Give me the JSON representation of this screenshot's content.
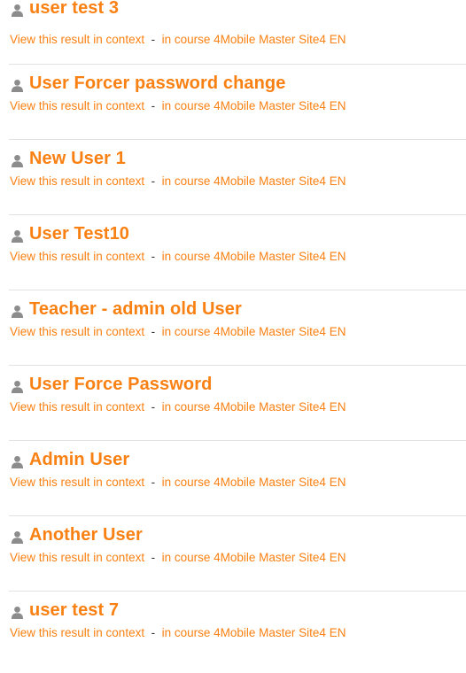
{
  "colors": {
    "accent": "#f98012",
    "divider": "#e2e2e2",
    "icon": "#8c8c8c"
  },
  "results": [
    {
      "title": "user test 3",
      "context_link": "View this result in context",
      "separator": "-",
      "course_link": "in course 4Mobile Master Site4 EN",
      "icon": "user-icon"
    },
    {
      "title": "User Forcer password change",
      "context_link": "View this result in context",
      "separator": "-",
      "course_link": "in course 4Mobile Master Site4 EN",
      "icon": "user-icon"
    },
    {
      "title": "New User 1",
      "context_link": "View this result in context",
      "separator": "-",
      "course_link": "in course 4Mobile Master Site4 EN",
      "icon": "user-icon"
    },
    {
      "title": "User Test10",
      "context_link": "View this result in context",
      "separator": "-",
      "course_link": "in course 4Mobile Master Site4 EN",
      "icon": "user-icon"
    },
    {
      "title": "Teacher - admin old User",
      "context_link": "View this result in context",
      "separator": "-",
      "course_link": "in course 4Mobile Master Site4 EN",
      "icon": "user-icon"
    },
    {
      "title": "User Force Password",
      "context_link": "View this result in context",
      "separator": "-",
      "course_link": "in course 4Mobile Master Site4 EN",
      "icon": "user-icon"
    },
    {
      "title": "Admin User",
      "context_link": "View this result in context",
      "separator": "-",
      "course_link": "in course 4Mobile Master Site4 EN",
      "icon": "user-icon"
    },
    {
      "title": "Another User",
      "context_link": "View this result in context",
      "separator": "-",
      "course_link": "in course 4Mobile Master Site4 EN",
      "icon": "user-icon"
    },
    {
      "title": "user test 7",
      "context_link": "View this result in context",
      "separator": "-",
      "course_link": "in course 4Mobile Master Site4 EN",
      "icon": "user-icon"
    }
  ]
}
